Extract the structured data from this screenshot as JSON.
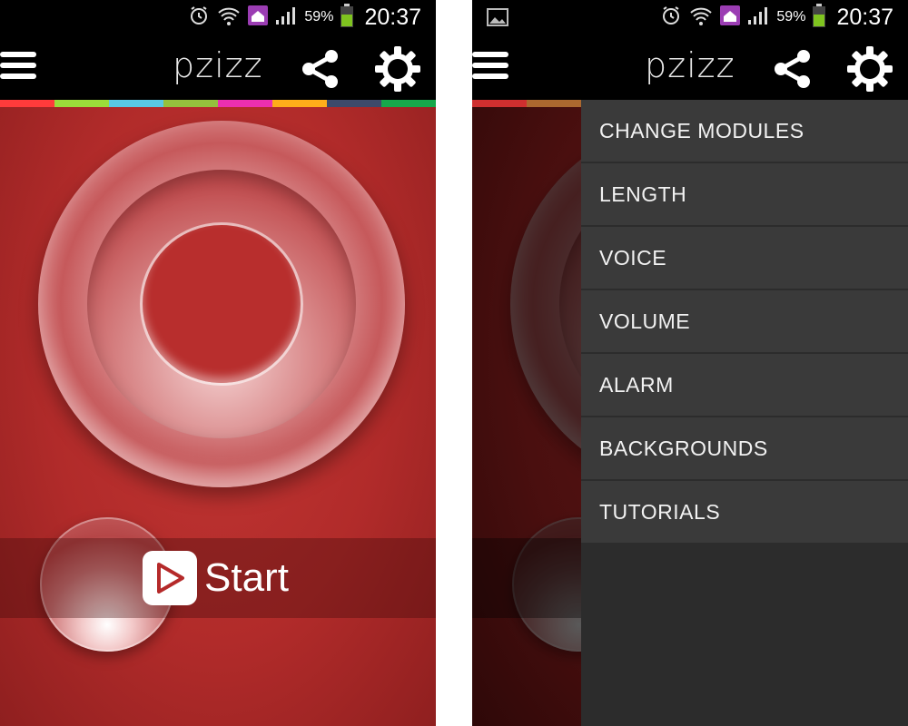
{
  "status_bar": {
    "battery_percent": "59%",
    "time": "20:37",
    "icons": [
      "alarm-icon",
      "wifi-icon",
      "home-notification-icon",
      "signal-icon",
      "battery-icon"
    ],
    "gallery_icon": "image-icon"
  },
  "app_bar": {
    "logo_text": "pzizz",
    "menu_icon": "hamburger-menu-icon",
    "share_icon": "share-icon",
    "settings_icon": "gear-icon"
  },
  "color_strip": [
    "#ff3b3b",
    "#9bdc3a",
    "#59c8e4",
    "#95c13d",
    "#ec2fb0",
    "#ffad1a",
    "#3c4a6a",
    "#16a84b"
  ],
  "main": {
    "start_label": "Start",
    "accent_color": "#b52a2a"
  },
  "drawer": {
    "items": [
      {
        "label": "CHANGE MODULES"
      },
      {
        "label": "LENGTH"
      },
      {
        "label": "VOICE"
      },
      {
        "label": "VOLUME"
      },
      {
        "label": "ALARM"
      },
      {
        "label": "BACKGROUNDS"
      },
      {
        "label": "TUTORIALS"
      }
    ]
  }
}
